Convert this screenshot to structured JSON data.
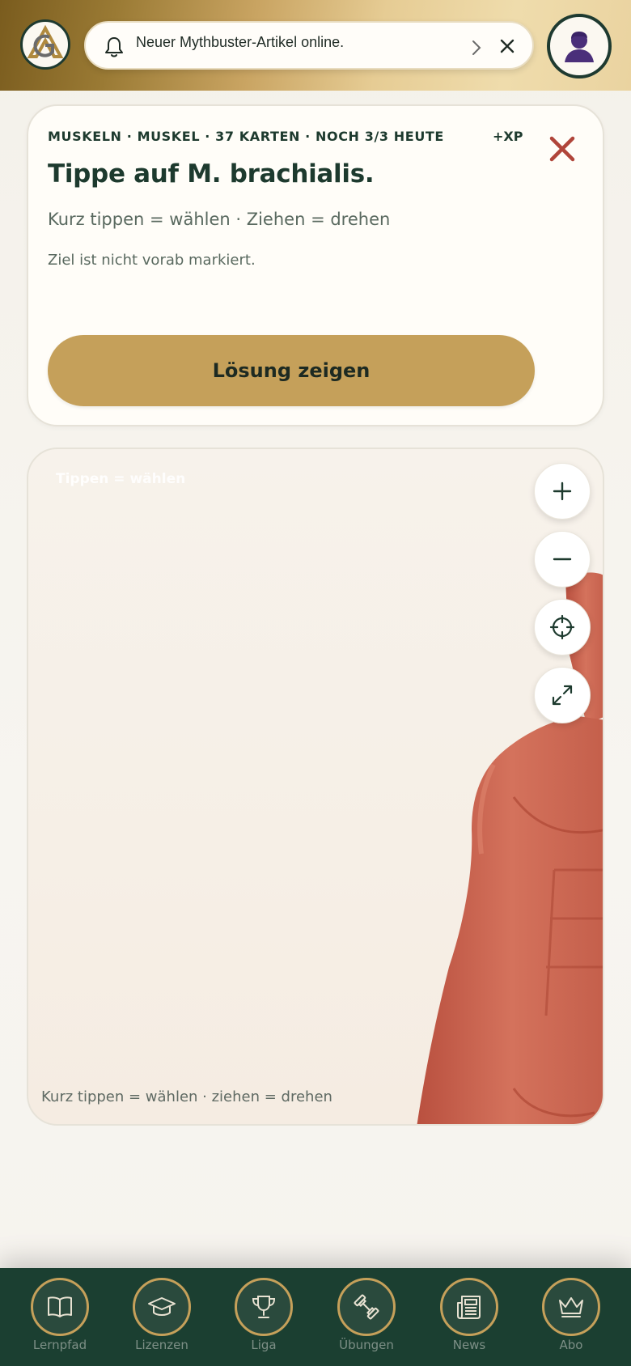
{
  "header": {
    "logo_icon": "ga-logo-icon",
    "notification": {
      "text": "Neuer Mythbuster-Artikel online.",
      "icon": "bell-icon"
    },
    "avatar_icon": "user-silhouette-icon"
  },
  "quiz": {
    "meta": "MUSKELN · MUSKEL · 37 KARTEN · NOCH 3/3 HEUTE",
    "xp": "+XP",
    "question": "Tippe auf M. brachialis.",
    "instruction": "Kurz tippen = wählen · Ziehen = drehen",
    "hint": "Ziel ist nicht vorab markiert.",
    "solution_button": "Lösung zeigen"
  },
  "viewer": {
    "overlay_label": "Tippen = wählen",
    "footer_hint": "Kurz tippen = wählen · ziehen = drehen",
    "controls": [
      "zoom-in-icon",
      "zoom-out-icon",
      "recenter-icon",
      "fullscreen-icon"
    ]
  },
  "nav": {
    "items": [
      {
        "label": "Lernpfad",
        "icon": "book-icon"
      },
      {
        "label": "Lizenzen",
        "icon": "graduation-cap-icon"
      },
      {
        "label": "Liga",
        "icon": "trophy-icon"
      },
      {
        "label": "Übungen",
        "icon": "dumbbell-icon"
      },
      {
        "label": "News",
        "icon": "newspaper-icon"
      },
      {
        "label": "Abo",
        "icon": "crown-icon"
      }
    ]
  },
  "colors": {
    "brand_green": "#1b3f31",
    "brand_gold": "#c5a05a",
    "close_red": "#b0453a",
    "muscle": "#c9644f"
  }
}
